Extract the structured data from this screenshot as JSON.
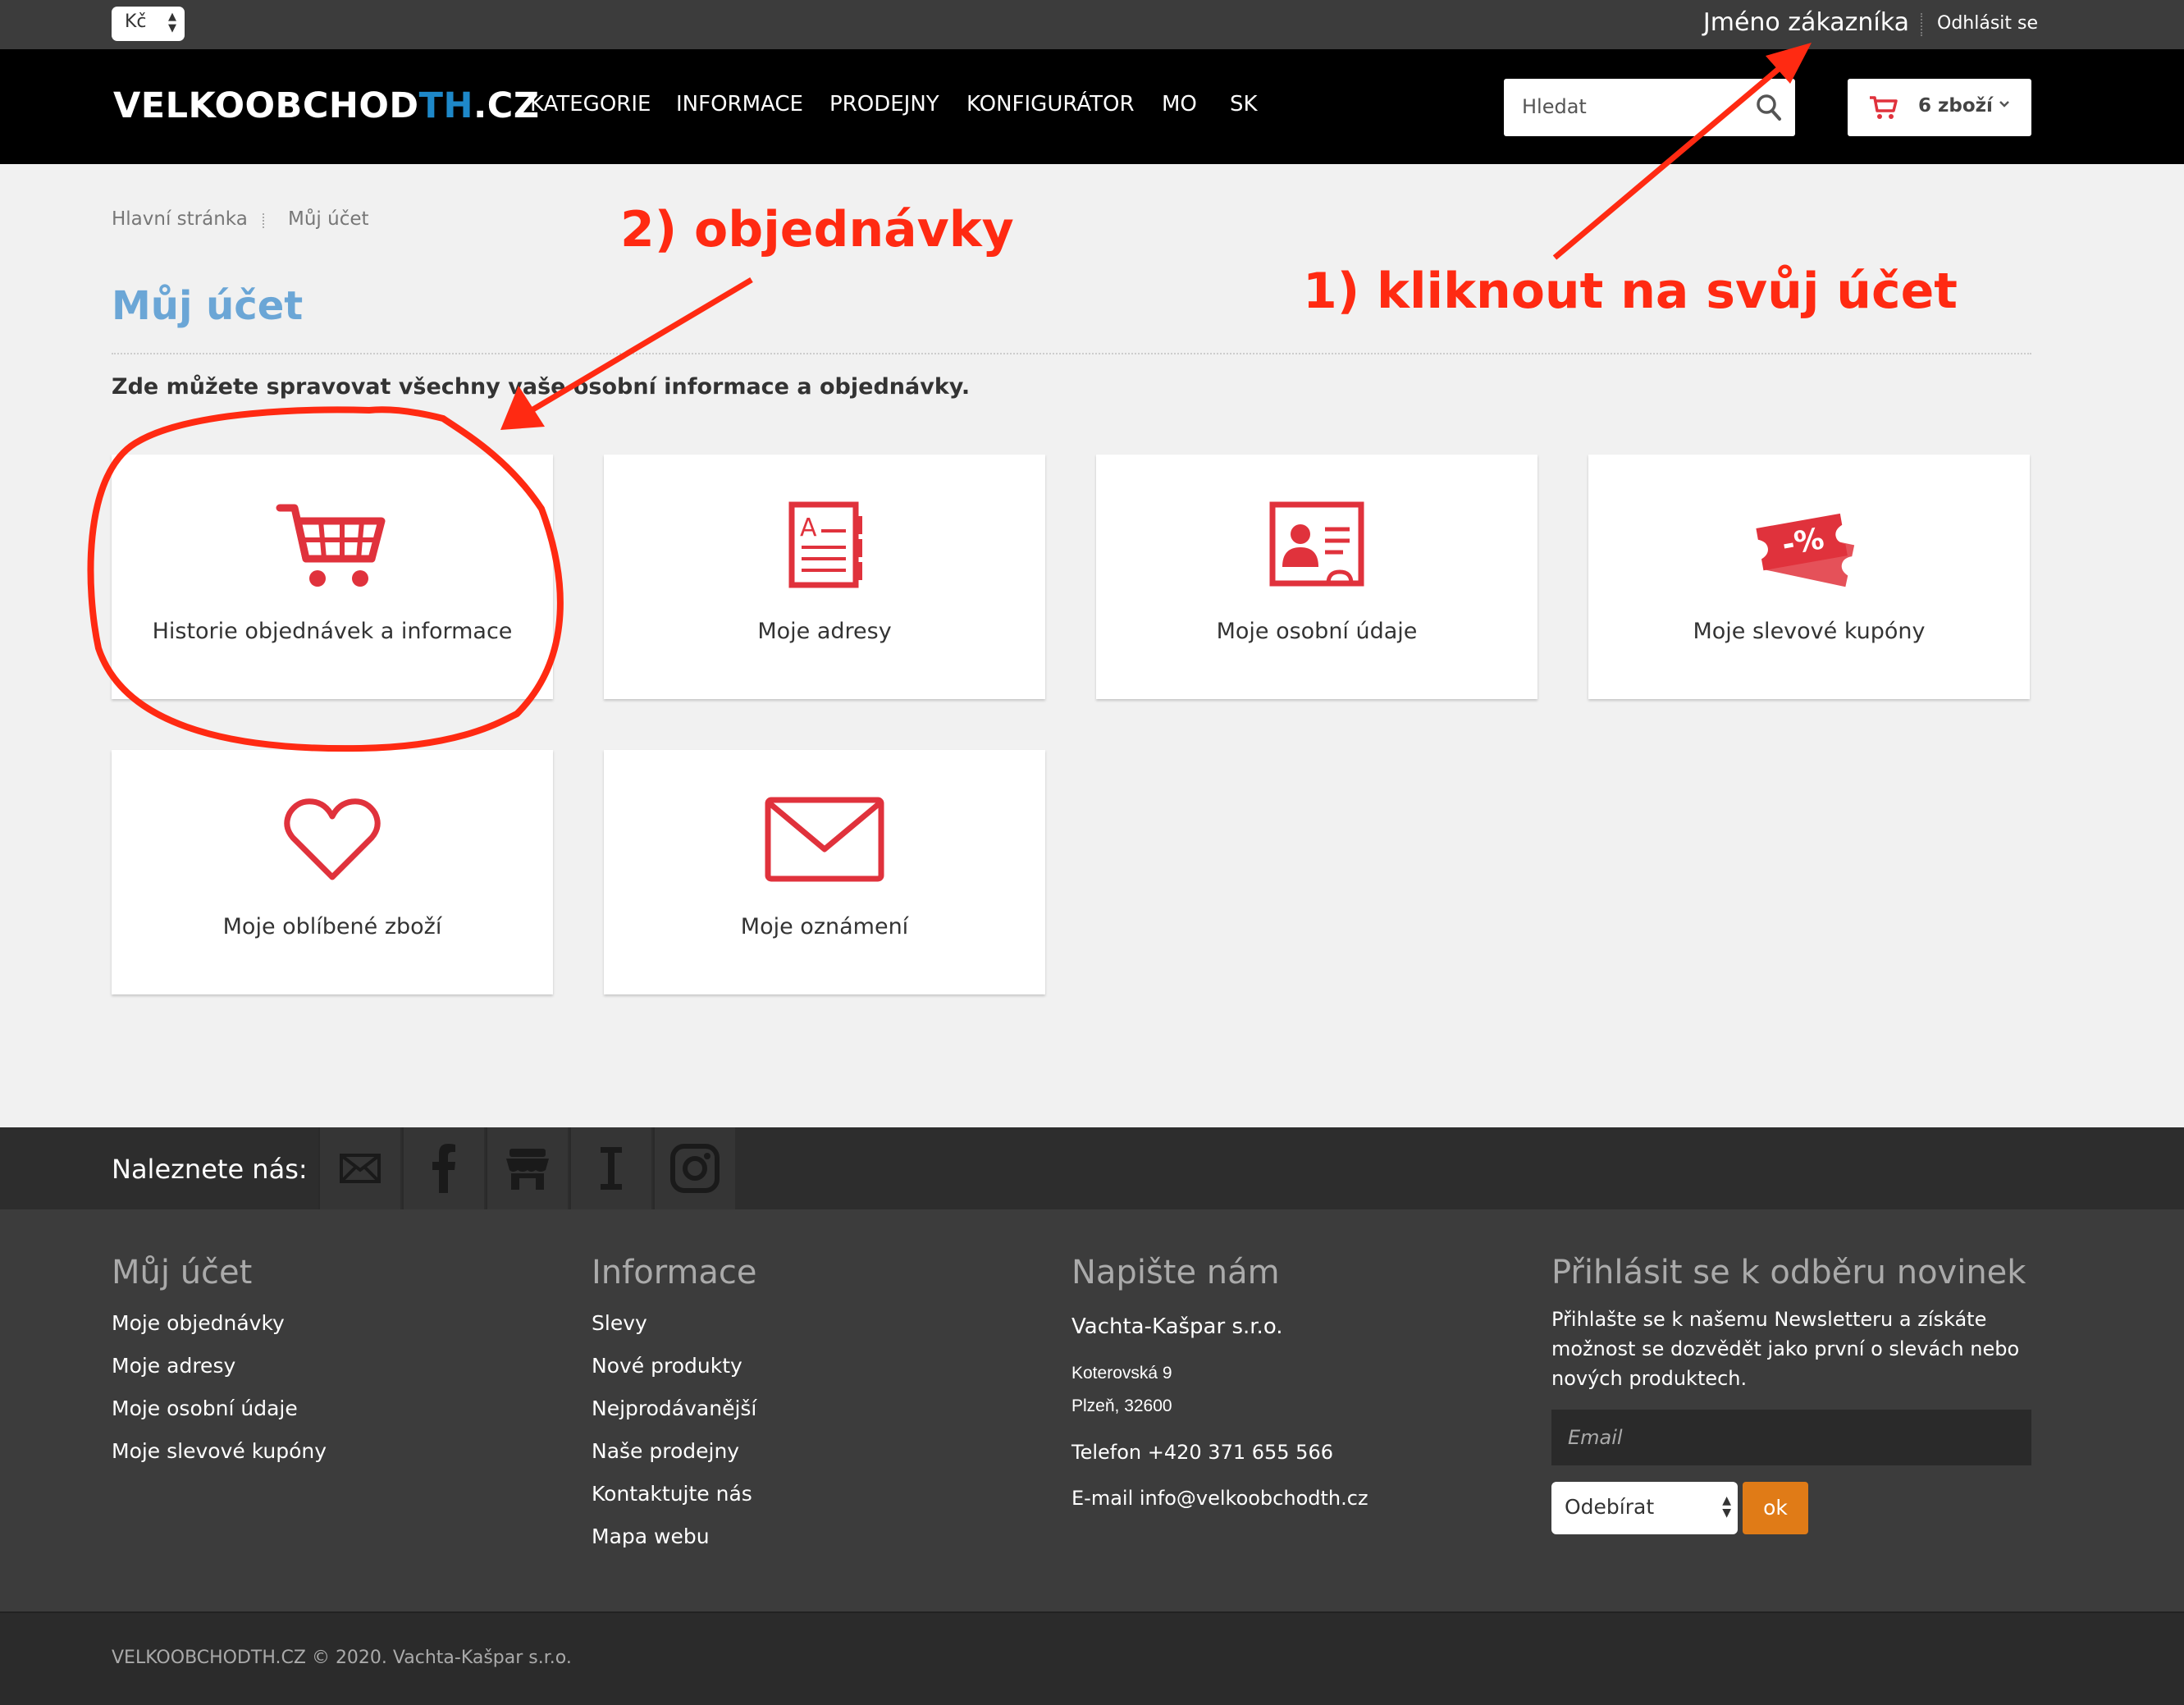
{
  "topbar": {
    "currency": "Kč",
    "username": "Jméno zákazníka",
    "logout": "Odhlásit se"
  },
  "header": {
    "logo_part1": "VELKOOBCHOD",
    "logo_part2": "TH",
    "logo_part3": ".CZ",
    "nav": [
      "KATEGORIE",
      "INFORMACE",
      "PRODEJNY",
      "KONFIGURÁTOR",
      "MO",
      "SK"
    ],
    "search_placeholder": "Hledat",
    "cart_count": "6 zboží"
  },
  "breadcrumb": {
    "home": "Hlavní stránka",
    "current": "Můj účet"
  },
  "page": {
    "title": "Můj účet",
    "intro": "Zde můžete spravovat všechny vaše osobní informace a objednávky."
  },
  "tiles": [
    {
      "label": "Historie objednávek a informace",
      "icon": "cart-icon"
    },
    {
      "label": "Moje adresy",
      "icon": "address-book-icon"
    },
    {
      "label": "Moje osobní údaje",
      "icon": "id-card-icon"
    },
    {
      "label": "Moje slevové kupóny",
      "icon": "discount-coupon-icon"
    },
    {
      "label": "Moje oblíbené zboží",
      "icon": "heart-icon"
    },
    {
      "label": "Moje oznámení",
      "icon": "envelope-icon"
    }
  ],
  "annotations": {
    "step1": "1) kliknout na svůj účet",
    "step2": "2) objednávky"
  },
  "social": {
    "label": "Naleznete nás:",
    "icons": [
      "mail-icon",
      "facebook-icon",
      "shop-icon",
      "info-icon",
      "instagram-icon"
    ]
  },
  "footer": {
    "account": {
      "heading": "Můj účet",
      "links": [
        "Moje objednávky",
        "Moje adresy",
        "Moje osobní údaje",
        "Moje slevové kupóny"
      ]
    },
    "info": {
      "heading": "Informace",
      "links": [
        "Slevy",
        "Nové produkty",
        "Nejprodávanější",
        "Naše prodejny",
        "Kontaktujte nás",
        "Mapa webu"
      ]
    },
    "contact": {
      "heading": "Napište nám",
      "company": "Vachta-Kašpar s.r.o.",
      "street": "Koterovská 9",
      "city": "Plzeň, 32600",
      "phone": "Telefon +420 371 655 566",
      "email": "E-mail info@velkoobchodth.cz"
    },
    "newsletter": {
      "heading": "Přihlásit se k odběru novinek",
      "text": "Přihlašte se k našemu Newsletteru a získáte možnost se dozvědět jako první o slevách nebo nových produktech.",
      "email_placeholder": "Email",
      "select_value": "Odebírat",
      "ok": "ok"
    }
  },
  "copyright": "VELKOOBCHODTH.CZ © 2020. Vachta-Kašpar s.r.o.",
  "colors": {
    "accent_red": "#e0323c",
    "title_blue": "#6ba6d6",
    "annotation_red": "#ff2a12",
    "ok_orange": "#e07b17"
  }
}
